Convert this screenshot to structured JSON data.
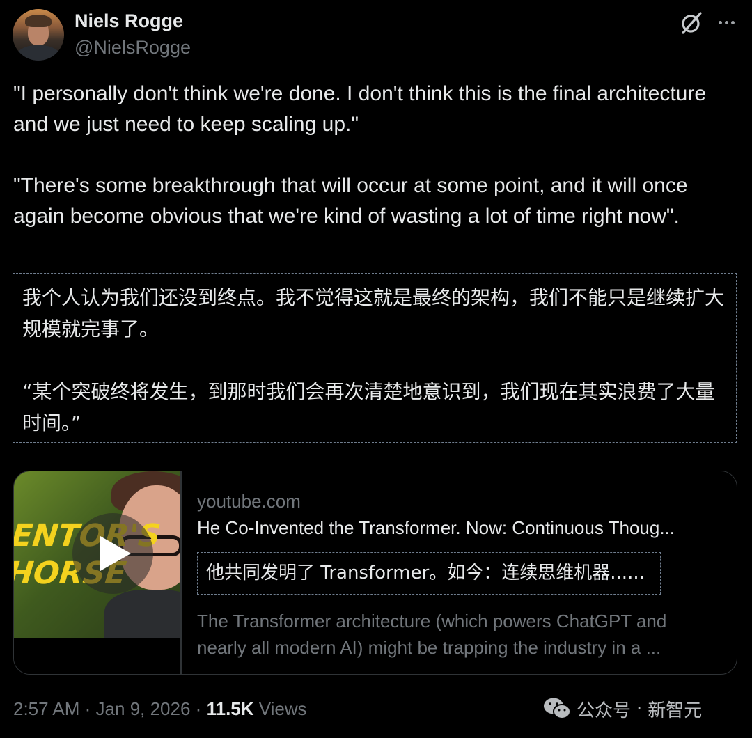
{
  "author": {
    "display_name": "Niels Rogge",
    "handle": "@NielsRogge"
  },
  "header_icons": [
    "grok-icon",
    "more-icon"
  ],
  "tweet": {
    "paragraph_1": "\"I personally don't think we're done. I don't think this is the final architecture and we just need to keep scaling up.\"",
    "paragraph_2": "\"There's some breakthrough that will occur at some point, and it will once again become obvious that we're kind of wasting a lot of time right now\"."
  },
  "translation": {
    "paragraph_1": "我个人认为我们还没到终点。我不觉得这就是最终的架构，我们不能只是继续扩大规模就完事了。",
    "paragraph_2": "“某个突破终将发生，到那时我们会再次清楚地意识到，我们现在其实浪费了大量时间。”"
  },
  "link_card": {
    "thumbnail_text_line_1": "ENTOR'S",
    "thumbnail_text_line_2": "HORSE",
    "domain": "youtube.com",
    "title": "He Co-Invented the Transformer. Now: Continuous Thoug...",
    "title_translation": "他共同发明了 Transformer。如今：连续思维机器......",
    "description_line_1": "The Transformer architecture (which powers ChatGPT and",
    "description_line_2": "nearly all modern AI) might be trapping the industry in a ..."
  },
  "meta": {
    "time": "2:57 AM",
    "separator": "·",
    "date": "Jan 9, 2026",
    "views_count": "11.5K",
    "views_label": "Views"
  },
  "watermark": {
    "account_type": "公众号",
    "dot": "·",
    "name": "新智元"
  },
  "colors": {
    "background": "#000000",
    "primary_text": "#e7e9ea",
    "secondary_text": "#71767b",
    "border": "#2f3336",
    "dashed_border": "#6f7d8e"
  }
}
